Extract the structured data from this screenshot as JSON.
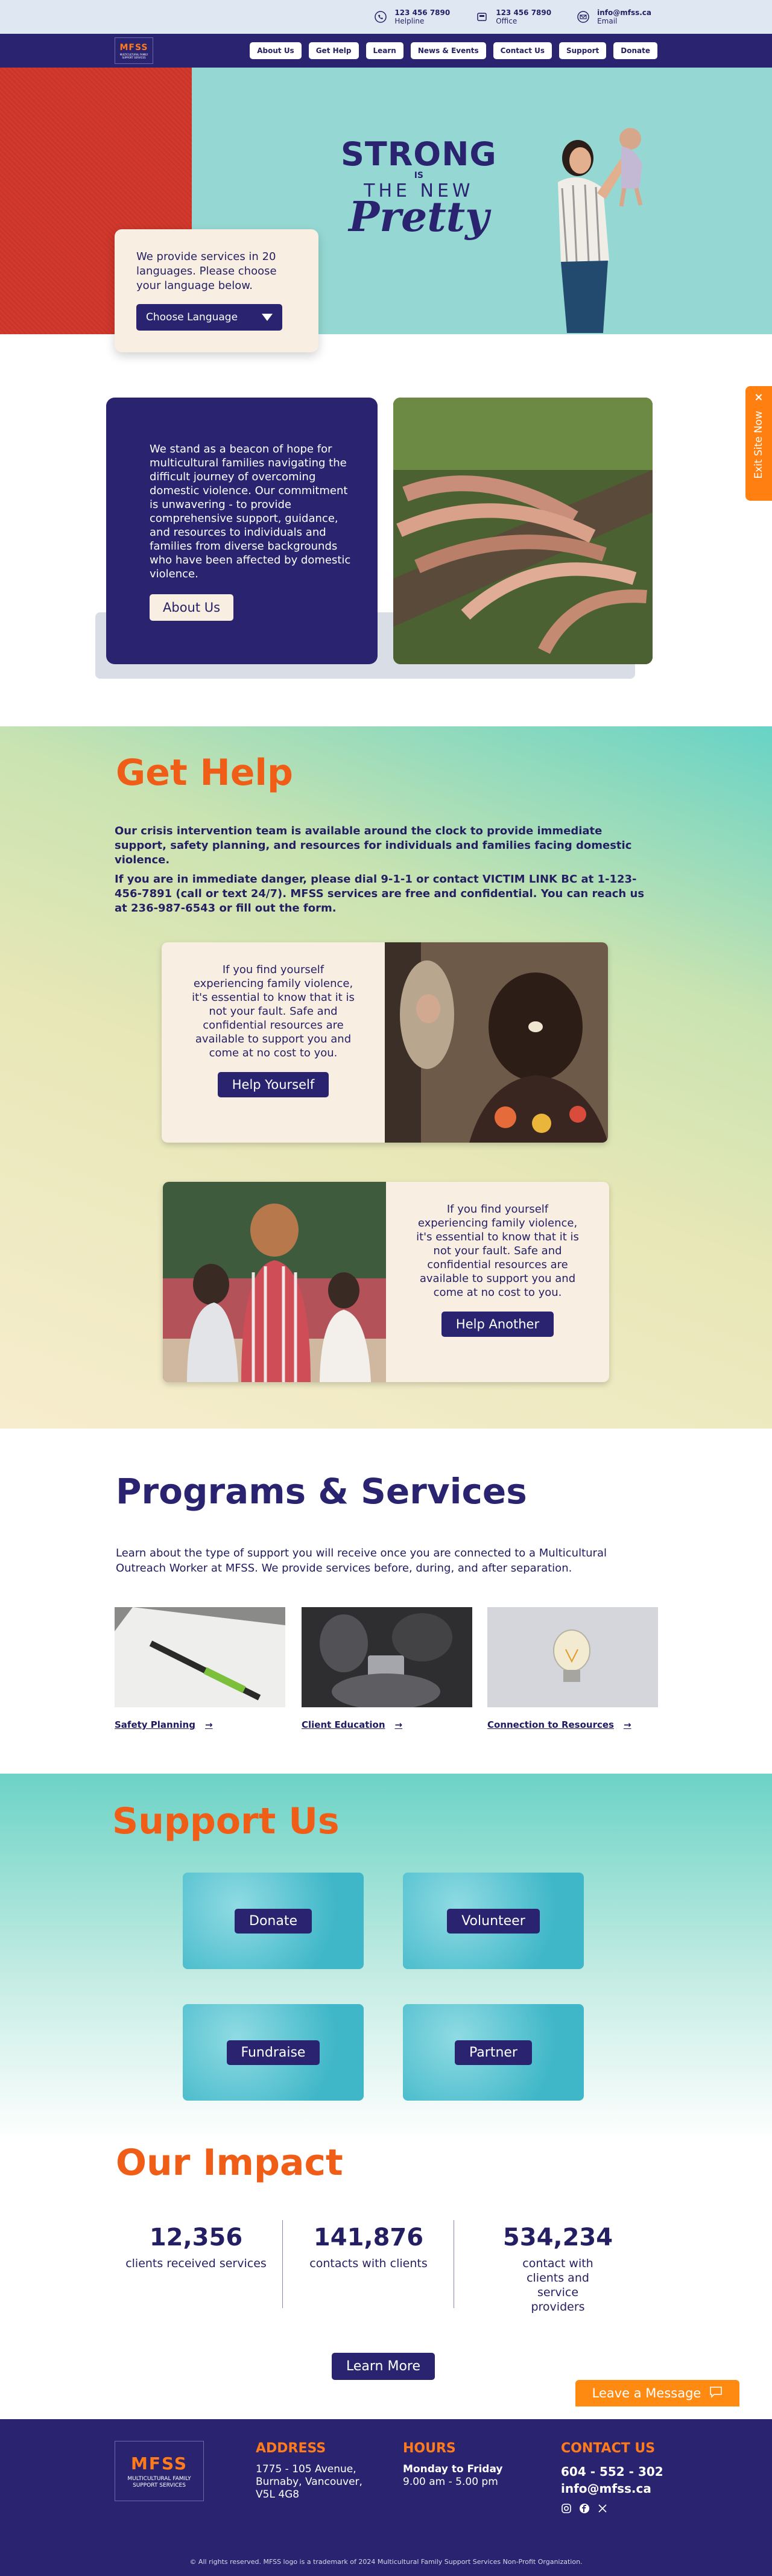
{
  "topbar": {
    "contacts": [
      {
        "icon": "phone-icon",
        "value": "123 456 7890",
        "label": "Helpline"
      },
      {
        "icon": "office-phone-icon",
        "value": "123 456 7890",
        "label": "Office"
      },
      {
        "icon": "email-icon",
        "value": "info@mfss.ca",
        "label": "Email"
      }
    ]
  },
  "nav": {
    "logo_text": "MFSS",
    "logo_sub": "MULTICULTURAL FAMILY SUPPORT SERVICES",
    "links": [
      "About Us",
      "Get Help",
      "Learn",
      "News & Events",
      "Contact Us",
      "Support",
      "Donate"
    ]
  },
  "hero": {
    "line1": "STRONG",
    "line2": "IS",
    "line3": "THE NEW",
    "line4": "Pretty"
  },
  "language": {
    "text": "We provide services in 20 languages. Please choose your language below.",
    "select_label": "Choose Language"
  },
  "exit": {
    "label": "Exit Site Now",
    "close": "×"
  },
  "about": {
    "text": "We stand as a beacon of hope for multicultural families navigating the difficult journey of overcoming domestic violence. Our commitment is unwavering - to provide comprehensive support, guidance, and resources to individuals and families from diverse backgrounds who have been affected by domestic violence.",
    "button": "About Us"
  },
  "gethelp": {
    "title": "Get Help",
    "p1": "Our crisis intervention team is available around the clock to provide immediate support, safety planning, and resources for individuals and families facing domestic violence.",
    "p2": "If you are in immediate danger, please dial 9-1-1 or contact VICTIM LINK BC at 1-123-456-7891 (call or text 24/7). MFSS services are free and confidential. You can reach us at 236-987-6543 or fill out the form.",
    "card1_text": "If you find yourself experiencing family violence, it's essential to know that it is not your fault. Safe and confidential resources are available to support you and come at no cost to you.",
    "card1_button": "Help Yourself",
    "card2_text": "If you find yourself experiencing family violence, it's essential to know that it is not your fault. Safe and confidential resources are available to support you and come at no cost to you.",
    "card2_button": "Help Another"
  },
  "programs": {
    "title": "Programs & Services",
    "desc": "Learn about the type of support you will receive once you are connected to a Multicultural Outreach Worker at MFSS. We provide services before, during, and after separation.",
    "items": [
      "Safety Planning",
      "Client Education",
      "Connection to Resources"
    ]
  },
  "support": {
    "title": "Support Us",
    "tiles": [
      "Donate",
      "Volunteer",
      "Fundraise",
      "Partner"
    ]
  },
  "impact": {
    "title": "Our Impact",
    "stats": [
      {
        "number": "12,356",
        "label": "clients received services"
      },
      {
        "number": "141,876",
        "label": "contacts with clients"
      },
      {
        "number": "534,234",
        "label": "contact with clients and service providers"
      }
    ],
    "button": "Learn More",
    "leave_message": "Leave a Message"
  },
  "footer": {
    "logo_text": "MFSS",
    "logo_sub": "MULTICULTURAL FAMILY SUPPORT SERVICES",
    "address_title": "ADDRESS",
    "address": "1775 - 105 Avenue, Burnaby, Vancouver, V5L 4G8",
    "hours_title": "HOURS",
    "hours_days": "Monday to Friday",
    "hours_time": "9.00 am - 5.00 pm",
    "contact_title": "CONTACT US",
    "phone": "604 - 552 - 302",
    "email": "info@mfss.ca",
    "copyright": "© All rights reserved. MFSS logo is a trademark of 2024 Multicultural Family Support Services Non-Profit Organization."
  },
  "colors": {
    "navy": "#2a2470",
    "orange": "#f05d17",
    "cream": "#f8eee2",
    "teal": "#95d8d3",
    "red": "#d2382c"
  }
}
